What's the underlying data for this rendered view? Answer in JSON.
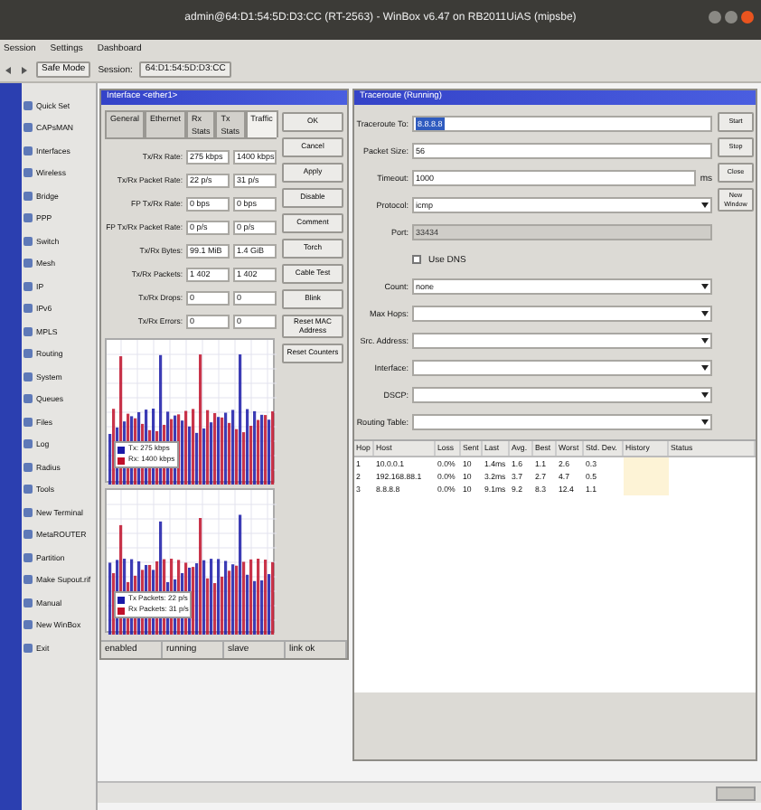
{
  "window": {
    "title": "admin@64:D1:54:5D:D3:CC (RT-2563) - WinBox v6.47 on RB2011UiAS (mipsbe)"
  },
  "menu": [
    "Session",
    "Settings",
    "Dashboard"
  ],
  "toolbar": {
    "safe_mode": "Safe Mode",
    "session_label": "Session:",
    "session_value": "64:D1:54:5D:D3:CC"
  },
  "sidebar": {
    "items": [
      {
        "label": "Quick Set"
      },
      {
        "label": "CAPsMAN"
      },
      {
        "label": "Interfaces"
      },
      {
        "label": "Wireless"
      },
      {
        "label": "Bridge"
      },
      {
        "label": "PPP"
      },
      {
        "label": "Switch"
      },
      {
        "label": "Mesh"
      },
      {
        "label": "IP"
      },
      {
        "label": "IPv6"
      },
      {
        "label": "MPLS"
      },
      {
        "label": "Routing"
      },
      {
        "label": "System"
      },
      {
        "label": "Queues"
      },
      {
        "label": "Files"
      },
      {
        "label": "Log"
      },
      {
        "label": "Radius"
      },
      {
        "label": "Tools"
      },
      {
        "label": "New Terminal"
      },
      {
        "label": "MetaROUTER"
      },
      {
        "label": "Partition"
      },
      {
        "label": "Make Supout.rif"
      },
      {
        "label": "Manual"
      },
      {
        "label": "New WinBox"
      },
      {
        "label": "Exit"
      }
    ]
  },
  "interface_window": {
    "title": "Interface <ether1>",
    "tabs": [
      {
        "label": "General",
        "selected": false
      },
      {
        "label": "Ethernet",
        "selected": false
      },
      {
        "label": "Rx Stats",
        "selected": false
      },
      {
        "label": "Tx Stats",
        "selected": false
      },
      {
        "label": "Traffic",
        "selected": true
      }
    ],
    "fields": [
      {
        "label": "Tx/Rx Rate:",
        "tx": "275 kbps",
        "rx": "1400 kbps"
      },
      {
        "label": "Tx/Rx Packet Rate:",
        "tx": "22 p/s",
        "rx": "31 p/s"
      },
      {
        "label": "FP Tx/Rx Rate:",
        "tx": "0 bps",
        "rx": "0 bps"
      },
      {
        "label": "FP Tx/Rx Packet Rate:",
        "tx": "0 p/s",
        "rx": "0 p/s"
      },
      {
        "label": "Tx/Rx Bytes:",
        "tx": "99.1 MiB",
        "rx": "1.4 GiB"
      },
      {
        "label": "Tx/Rx Packets:",
        "tx": "1 402",
        "rx": "1 402"
      },
      {
        "label": "Tx/Rx Drops:",
        "tx": "0",
        "rx": "0"
      },
      {
        "label": "Tx/Rx Errors:",
        "tx": "0",
        "rx": "0"
      }
    ],
    "buttons": [
      "OK",
      "Cancel",
      "Apply",
      "Disable",
      "Comment",
      "Torch",
      "Cable Test",
      "Blink",
      "Reset MAC Address",
      "Reset Counters"
    ],
    "graphs": [
      {
        "legend": [
          {
            "text": "Tx: 275 kbps",
            "color": "#1a1aa8"
          },
          {
            "text": "Rx: 1400 kbps",
            "color": "#c0102a"
          }
        ]
      },
      {
        "legend": [
          {
            "text": "Tx Packets: 22 p/s",
            "color": "#1a1aa8"
          },
          {
            "text": "Rx Packets: 31 p/s",
            "color": "#c0102a"
          }
        ]
      }
    ],
    "status": [
      "enabled",
      "running",
      "slave",
      "link ok"
    ]
  },
  "traceroute_window": {
    "title": "Traceroute (Running)",
    "fields": [
      {
        "kind": "input",
        "label": "Traceroute To:",
        "value": "8.8.8.8",
        "selected": true
      },
      {
        "kind": "input",
        "label": "Packet Size:",
        "value": "56"
      },
      {
        "kind": "input",
        "label": "Timeout:",
        "value": "1000",
        "unit": "ms"
      },
      {
        "kind": "dropdown",
        "label": "Protocol:",
        "value": "icmp"
      },
      {
        "kind": "input",
        "label": "Port:",
        "value": "33434",
        "disabled": true
      },
      {
        "kind": "checkbox",
        "label": "Use DNS",
        "checked": false
      },
      {
        "kind": "dropdown",
        "label": "Count:",
        "value": "none"
      },
      {
        "kind": "dropdown",
        "label": "Max Hops:"
      },
      {
        "kind": "dropdown",
        "label": "Src. Address:"
      },
      {
        "kind": "dropdown",
        "label": "Interface:"
      },
      {
        "kind": "dropdown",
        "label": "DSCP:"
      },
      {
        "kind": "dropdown",
        "label": "Routing Table:"
      }
    ],
    "buttons": [
      "Start",
      "Stop",
      "Close",
      "New Window"
    ],
    "table": {
      "columns": [
        "Hop",
        "Host",
        "Loss",
        "Sent",
        "Last",
        "Avg.",
        "Best",
        "Worst",
        "Std. Dev.",
        "History",
        "Status"
      ],
      "rows": [
        [
          "1",
          "10.0.0.1",
          "0.0%",
          "10",
          "1.4ms",
          "1.6",
          "1.1",
          "2.6",
          "0.3"
        ],
        [
          "2",
          "192.168.88.1",
          "0.0%",
          "10",
          "3.2ms",
          "3.7",
          "2.7",
          "4.7",
          "0.5"
        ],
        [
          "3",
          "8.8.8.8",
          "0.0%",
          "10",
          "9.1ms",
          "9.2",
          "8.3",
          "12.4",
          "1.1"
        ]
      ]
    }
  }
}
